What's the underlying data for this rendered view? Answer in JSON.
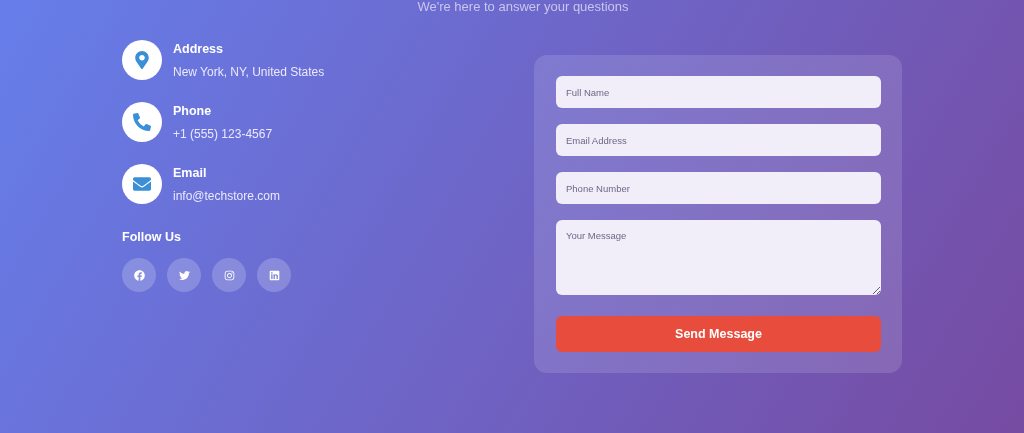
{
  "subtitle": "We're here to answer your questions",
  "contacts": [
    {
      "kind": "address",
      "title": "Address",
      "value": "New York, NY, United States"
    },
    {
      "kind": "phone",
      "title": "Phone",
      "value": "+1 (555) 123-4567"
    },
    {
      "kind": "email",
      "title": "Email",
      "value": "info@techstore.com"
    }
  ],
  "follow": {
    "title": "Follow Us",
    "networks": [
      {
        "kind": "facebook"
      },
      {
        "kind": "twitter"
      },
      {
        "kind": "instagram"
      },
      {
        "kind": "linkedin"
      }
    ]
  },
  "form": {
    "fields": [
      {
        "kind": "input",
        "placeholder": "Full Name"
      },
      {
        "kind": "input",
        "placeholder": "Email Address"
      },
      {
        "kind": "input",
        "placeholder": "Phone Number"
      },
      {
        "kind": "textarea",
        "placeholder": "Your Message"
      }
    ],
    "submit": "Send Message"
  }
}
